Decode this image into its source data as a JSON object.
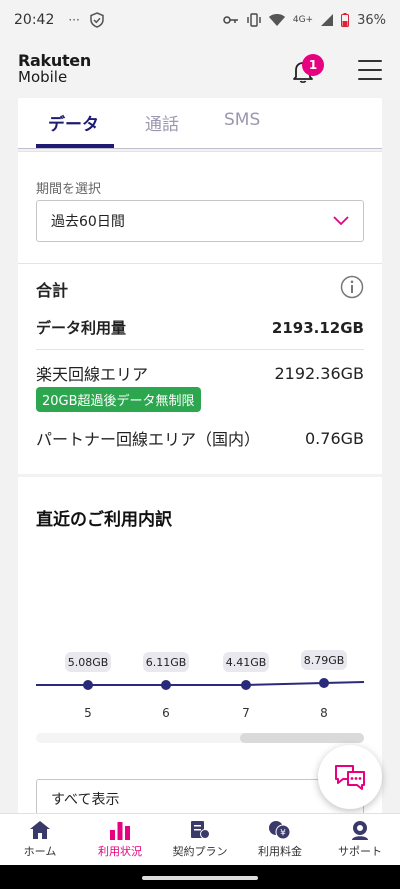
{
  "status": {
    "time": "20:42",
    "left_icons": [
      "dots-icon",
      "shield-check-icon"
    ],
    "right_icons": [
      "key-icon",
      "vibrate-icon",
      "wifi-icon",
      "signal-icon",
      "battery-icon"
    ],
    "network": "4G+",
    "battery": "36%"
  },
  "header": {
    "logo_line1": "Rakuten",
    "logo_line2": "Mobile",
    "notification_count": "1"
  },
  "tabs": [
    {
      "label": "データ",
      "active": true
    },
    {
      "label": "通話",
      "active": false
    },
    {
      "label": "SMS",
      "active": false
    }
  ],
  "period": {
    "label": "期間を選択",
    "selected": "過去60日間"
  },
  "total": {
    "title": "合計",
    "data_usage_label": "データ利用量",
    "data_usage_value": "2193.12GB",
    "rakuten_area_label": "楽天回線エリア",
    "rakuten_area_value": "2192.36GB",
    "tag": "20GB超過後データ無制限",
    "partner_area_label": "パートナー回線エリア（国内）",
    "partner_area_value": "0.76GB"
  },
  "recent": {
    "title": "直近のご利用内訳",
    "show_all": "すべて表示"
  },
  "chart_data": {
    "type": "line",
    "x": [
      "5",
      "6",
      "7",
      "8"
    ],
    "values": [
      5.08,
      6.11,
      4.41,
      8.79
    ],
    "labels": [
      "5.08GB",
      "6.11GB",
      "4.41GB",
      "8.79GB"
    ],
    "color": "#2a2a7a"
  },
  "nav": [
    {
      "label": "ホーム",
      "icon": "home-icon",
      "active": false
    },
    {
      "label": "利用状況",
      "icon": "bar-chart-icon",
      "active": true
    },
    {
      "label": "契約プラン",
      "icon": "contract-icon",
      "active": false
    },
    {
      "label": "利用料金",
      "icon": "billing-icon",
      "active": false
    },
    {
      "label": "サポート",
      "icon": "support-icon",
      "active": false
    }
  ],
  "colors": {
    "brand": "#1f1a72",
    "accent": "#e7007f",
    "tag_green": "#2da74f"
  }
}
